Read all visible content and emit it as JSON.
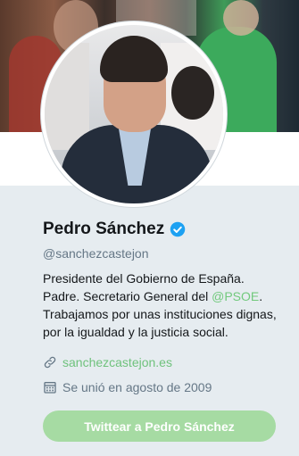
{
  "profile": {
    "name": "Pedro Sánchez",
    "handle": "@sanchezcastejon",
    "bio_line1": "Presidente del Gobierno de España.",
    "bio_line2_prefix": "Padre. Secretario General del ",
    "bio_mention": "@PSOE",
    "bio_line2_suffix": ".",
    "bio_line3": "Trabajamos por unas instituciones dignas,",
    "bio_line4": "por la igualdad y la justicia social.",
    "website": "sanchezcastejon.es",
    "joined": "Se unió en agosto de 2009",
    "tweet_button": "Twittear a Pedro Sánchez"
  },
  "icons": {
    "verified": "verified-badge-icon",
    "link": "link-icon",
    "calendar": "calendar-icon"
  },
  "colors": {
    "accent": "#71c97c",
    "button_bg": "#a6dba3",
    "verified": "#1da1f2",
    "text_primary": "#14171a",
    "text_secondary": "#657786",
    "background": "#e6ecf0"
  }
}
